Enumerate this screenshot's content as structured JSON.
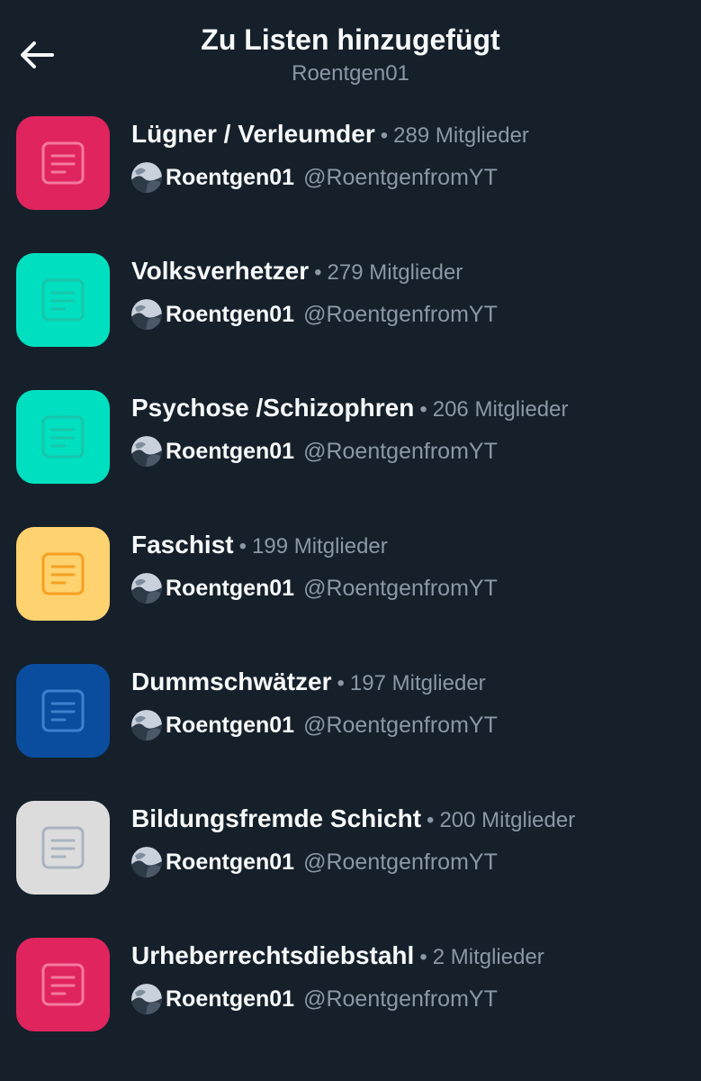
{
  "header": {
    "title": "Zu Listen hinzugefügt",
    "subtitle": "Roentgen01",
    "back_icon": "arrow-left-icon"
  },
  "separator": "•",
  "lists": [
    {
      "name": "Lügner / Verleumder",
      "members": "289 Mitglieder",
      "owner_name": "Roentgen01",
      "owner_handle": "@RoentgenfromYT",
      "tile_color": "#e0245e",
      "icon_color": "#f47a9f",
      "icon": "list-document-icon"
    },
    {
      "name": "Volksverhetzer",
      "members": "279 Mitglieder",
      "owner_name": "Roentgen01",
      "owner_handle": "@RoentgenfromYT",
      "tile_color": "#00e0c0",
      "icon_color": "#19c5aa",
      "icon": "list-document-icon"
    },
    {
      "name": "Psychose /Schizophren",
      "members": "206 Mitglieder",
      "owner_name": "Roentgen01",
      "owner_handle": "@RoentgenfromYT",
      "tile_color": "#00e0c0",
      "icon_color": "#19c5aa",
      "icon": "list-document-icon"
    },
    {
      "name": "Faschist",
      "members": "199 Mitglieder",
      "owner_name": "Roentgen01",
      "owner_handle": "@RoentgenfromYT",
      "tile_color": "#ffd270",
      "icon_color": "#f6a020",
      "icon": "list-document-icon"
    },
    {
      "name": "Dummschwätzer",
      "members": "197 Mitglieder",
      "owner_name": "Roentgen01",
      "owner_handle": "@RoentgenfromYT",
      "tile_color": "#0a4d9e",
      "icon_color": "#3f7fce",
      "icon": "list-document-icon"
    },
    {
      "name": "Bildungsfremde Schicht",
      "members": "200 Mitglieder",
      "owner_name": "Roentgen01",
      "owner_handle": "@RoentgenfromYT",
      "tile_color": "#dcdcdc",
      "icon_color": "#a9b3bf",
      "icon": "list-document-icon"
    },
    {
      "name": "Urheberrechtsdiebstahl",
      "members": "2 Mitglieder",
      "owner_name": "Roentgen01",
      "owner_handle": "@RoentgenfromYT",
      "tile_color": "#e0245e",
      "icon_color": "#f47a9f",
      "icon": "list-document-icon"
    }
  ]
}
